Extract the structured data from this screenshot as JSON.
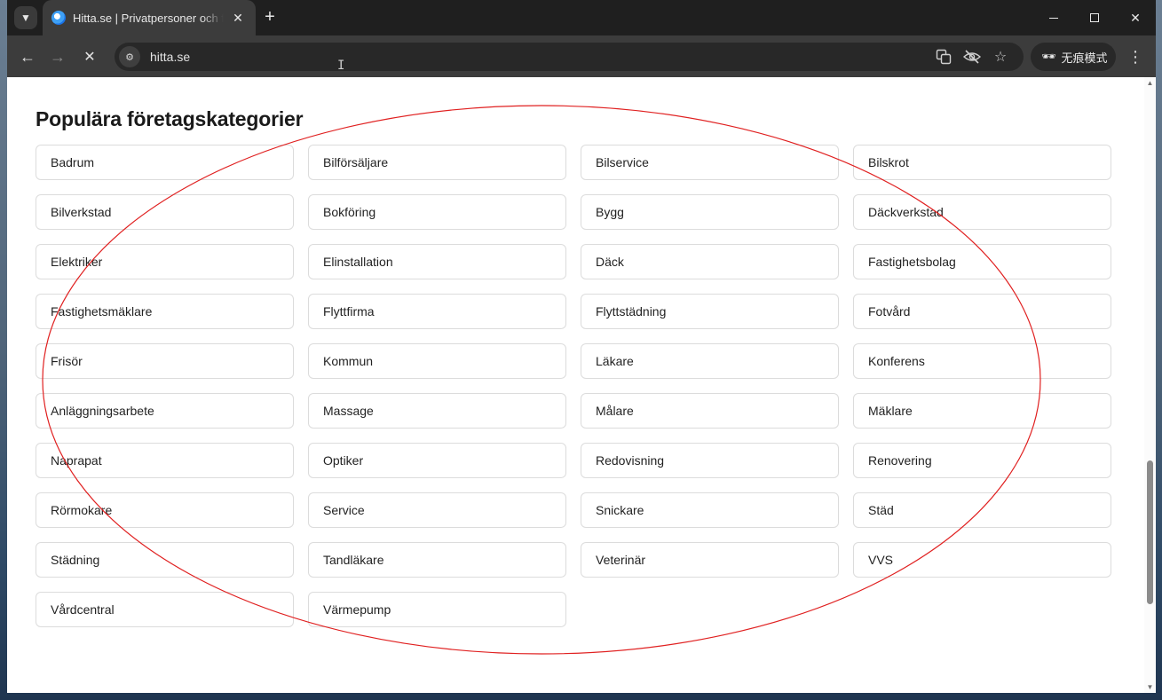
{
  "browser": {
    "tab_title": "Hitta.se | Privatpersoner och företag",
    "tab_close": "✕",
    "new_tab": "+",
    "url": "hitta.se",
    "incognito_label": "无痕模式"
  },
  "page": {
    "title": "Populära företagskategorier",
    "categories": [
      "Badrum",
      "Bilförsäljare",
      "Bilservice",
      "Bilskrot",
      "Bilverkstad",
      "Bokföring",
      "Bygg",
      "Däckverkstad",
      "Elektriker",
      "Elinstallation",
      "Däck",
      "Fastighetsbolag",
      "Fastighetsmäklare",
      "Flyttfirma",
      "Flyttstädning",
      "Fotvård",
      "Frisör",
      "Kommun",
      "Läkare",
      "Konferens",
      "Anläggningsarbete",
      "Massage",
      "Målare",
      "Mäklare",
      "Naprapat",
      "Optiker",
      "Redovisning",
      "Renovering",
      "Rörmokare",
      "Service",
      "Snickare",
      "Städ",
      "Städning",
      "Tandläkare",
      "Veterinär",
      "VVS",
      "Vårdcentral",
      "Värmepump"
    ]
  },
  "colors": {
    "annotation": "#e02020"
  }
}
